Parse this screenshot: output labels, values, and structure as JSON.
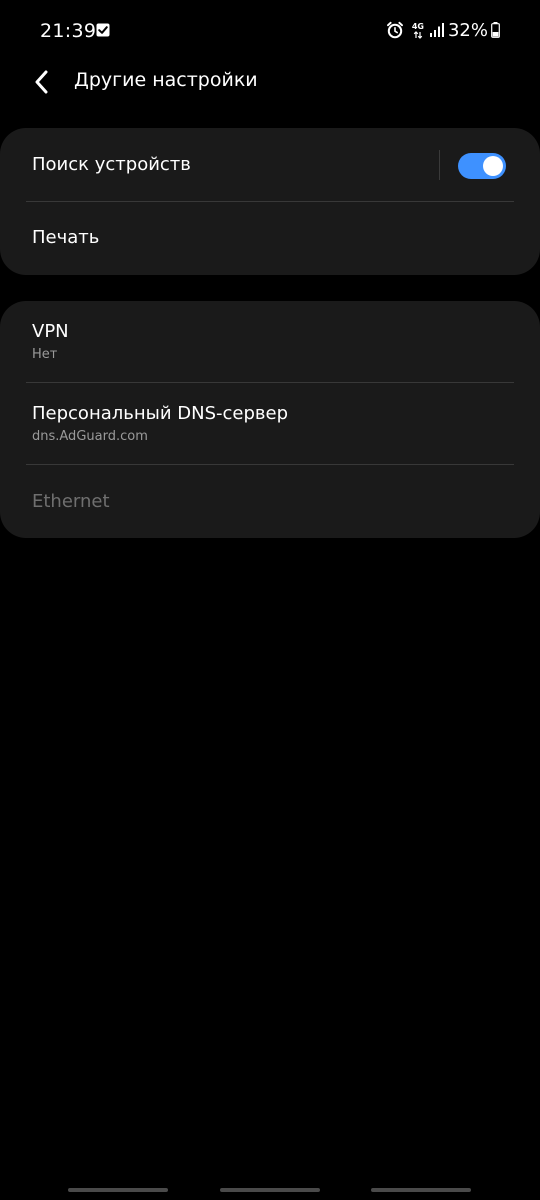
{
  "status_bar": {
    "time": "21:39",
    "network_type": "4G",
    "battery": "32%",
    "icons": [
      "checkbox-notification-icon",
      "alarm-icon",
      "data-arrows-icon",
      "signal-icon",
      "battery-icon"
    ]
  },
  "header": {
    "title": "Другие настройки",
    "back_icon": "chevron-left-icon"
  },
  "group1": {
    "device_search": {
      "title": "Поиск устройств",
      "toggle_on": true
    },
    "printing": {
      "title": "Печать"
    }
  },
  "group2": {
    "vpn": {
      "title": "VPN",
      "subtitle": "Нет"
    },
    "private_dns": {
      "title": "Персональный DNS-сервер",
      "subtitle": "dns.AdGuard.com"
    },
    "ethernet": {
      "title": "Ethernet",
      "enabled": false
    }
  },
  "colors": {
    "background": "#000000",
    "card": "#1a1a1a",
    "accent": "#3e91ff",
    "subtitle": "#9a9a9a",
    "disabled": "#6f6f6f"
  }
}
